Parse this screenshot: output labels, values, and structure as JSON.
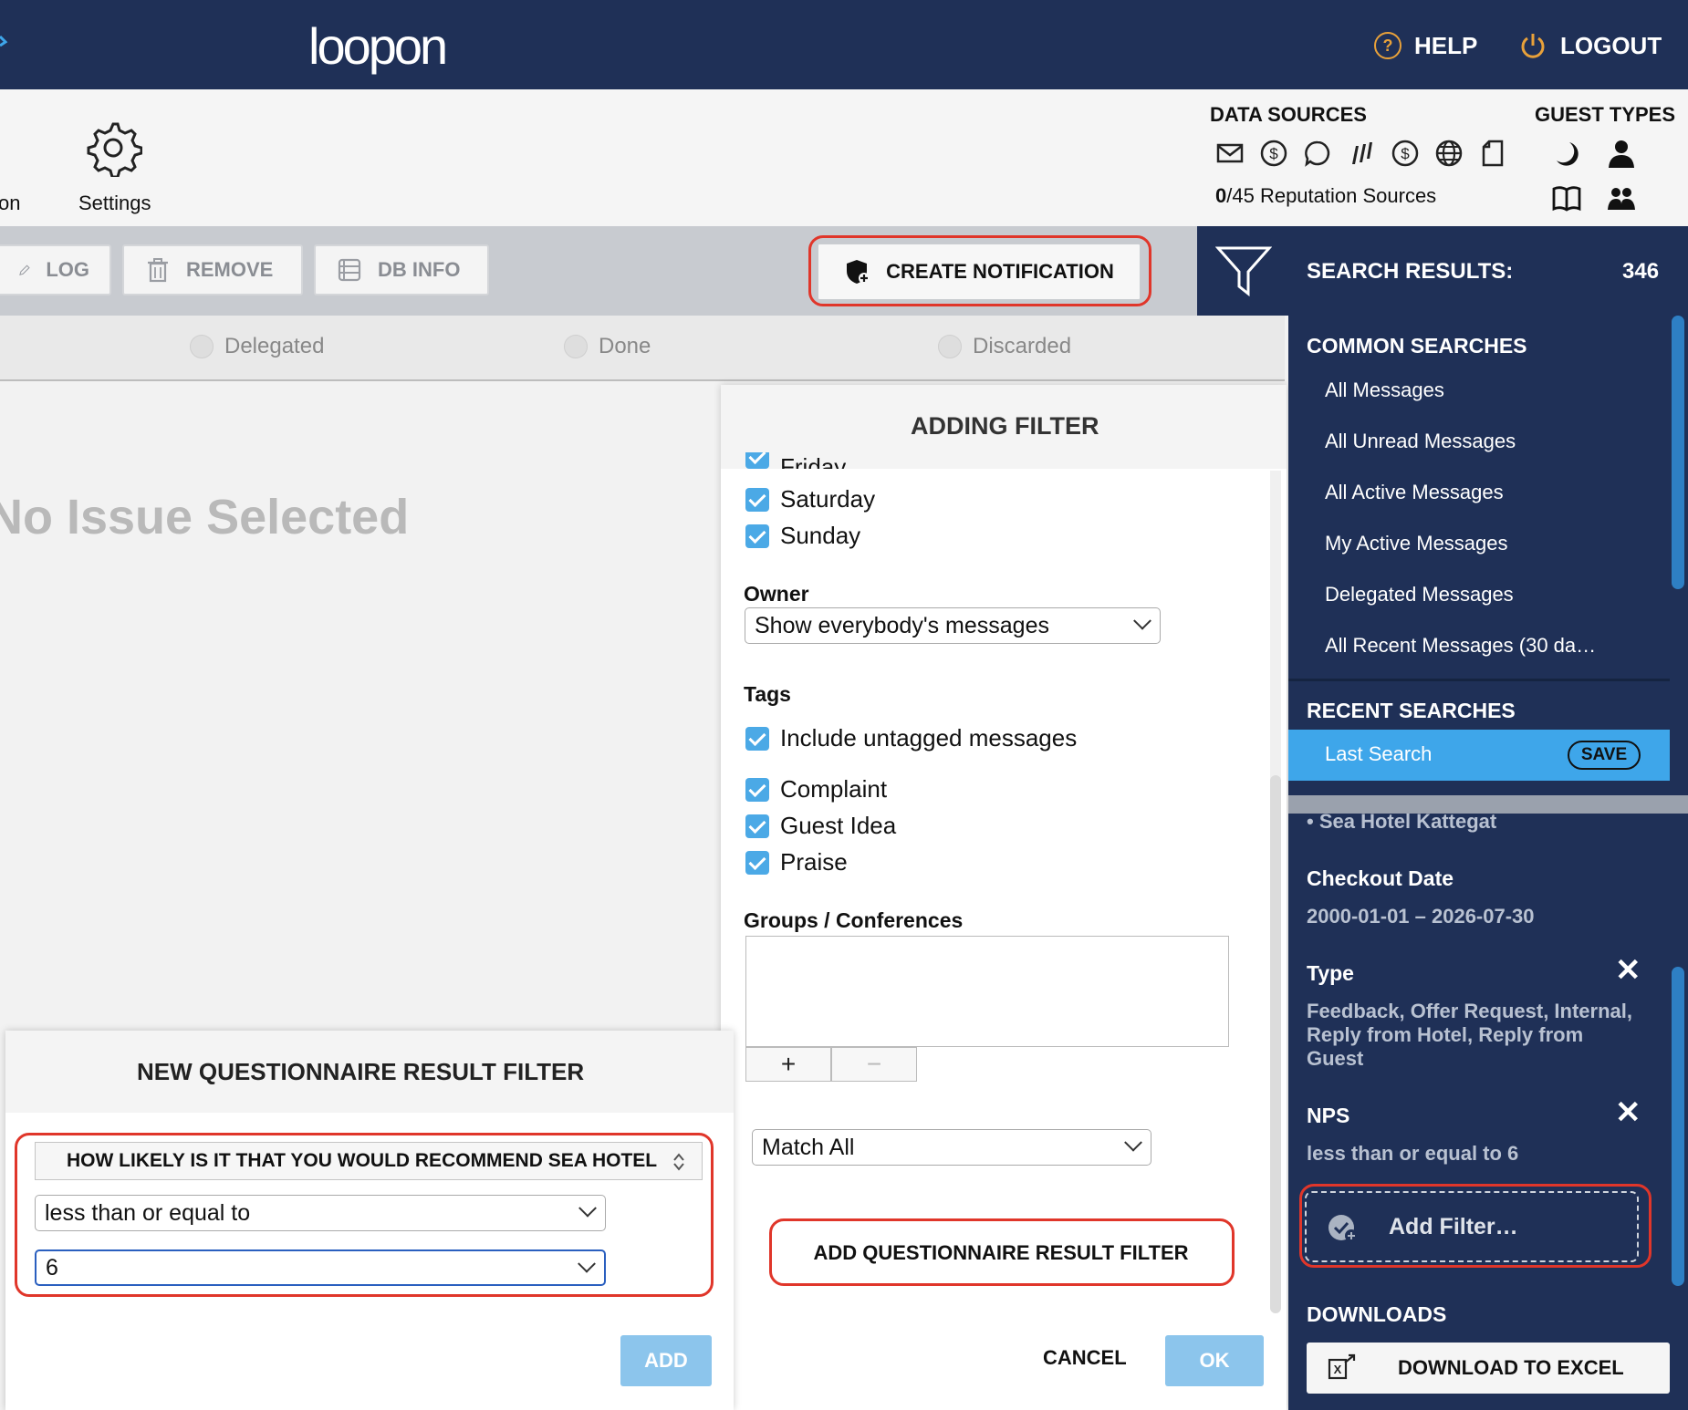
{
  "app": {
    "logo": "loopon"
  },
  "topbar": {
    "help_label": "HELP",
    "logout_label": "LOGOUT"
  },
  "nav": {
    "partial_label": "on",
    "settings_label": "Settings"
  },
  "data_sources": {
    "heading": "DATA SOURCES",
    "icons": [
      "mail-icon",
      "dollar-icon",
      "chat-bubble-icon",
      "bars-icon",
      "dollar-icon",
      "globe-icon",
      "document-icon"
    ],
    "rep_count": "0",
    "rep_suffix": "/45 Reputation Sources"
  },
  "guest_types": {
    "heading": "GUEST TYPES",
    "icons": [
      "moon-icon",
      "person-icon",
      "book-icon",
      "group-icon"
    ]
  },
  "toolbar": {
    "log_label": "LOG",
    "remove_label": "REMOVE",
    "db_info_label": "DB INFO",
    "create_notification_label": "CREATE NOTIFICATION"
  },
  "search_results": {
    "label": "SEARCH RESULTS:",
    "count": "346"
  },
  "status_filters": [
    "Delegated",
    "Done",
    "Discarded"
  ],
  "main": {
    "empty_text": "No Issue Selected"
  },
  "adding_filter": {
    "title": "ADDING FILTER",
    "partial_day": "Friday",
    "days": [
      "Saturday",
      "Sunday"
    ],
    "owner_label": "Owner",
    "owner_value": "Show everybody's messages",
    "tags_label": "Tags",
    "untagged_label": "Include untagged messages",
    "tags": [
      "Complaint",
      "Guest Idea",
      "Praise"
    ],
    "groups_label": "Groups / Conferences",
    "plus": "+",
    "minus": "−",
    "match_value": "Match All",
    "add_qrf_label": "ADD QUESTIONNAIRE RESULT FILTER",
    "cancel_label": "CANCEL",
    "ok_label": "OK"
  },
  "new_questionnaire": {
    "title": "NEW QUESTIONNAIRE RESULT FILTER",
    "question": "HOW LIKELY IS IT THAT YOU WOULD RECOMMEND SEA HOTEL",
    "operator": "less than or equal to",
    "value": "6",
    "add_label": "ADD"
  },
  "sidebar": {
    "common_heading": "COMMON SEARCHES",
    "common_items": [
      "All Messages",
      "All Unread Messages",
      "All Active Messages",
      "My Active Messages",
      "Delegated Messages",
      "All Recent Messages (30 da…"
    ],
    "recent_heading": "RECENT SEARCHES",
    "last_search_label": "Last Search",
    "save_label": "SAVE",
    "hotel_line": "• Sea Hotel Kattegat",
    "filters": {
      "checkout_title": "Checkout Date",
      "checkout_value": "2000-01-01 – 2026-07-30",
      "type_title": "Type",
      "type_value": "Feedback, Offer Request, Internal, Reply from Hotel, Reply from Guest",
      "nps_title": "NPS",
      "nps_value": "less than or equal to 6"
    },
    "add_filter_label": "Add Filter…",
    "downloads_heading": "DOWNLOADS",
    "download_excel_label": "DOWNLOAD TO EXCEL"
  },
  "colors": {
    "navy": "#1f3057",
    "accent_blue": "#3ea6ea",
    "highlight_red": "#e0362a",
    "help_orange": "#e8a13a"
  }
}
